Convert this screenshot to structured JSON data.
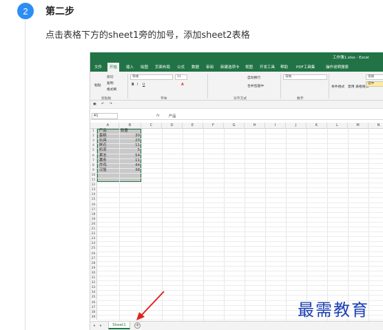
{
  "step": {
    "number": "2",
    "title": "第二步",
    "description": "点击表格下方的sheet1旁的加号，添加sheet2表格"
  },
  "excel": {
    "window_title": "工作簿1.xlsx - Excel",
    "menu": [
      "文件",
      "开始",
      "插入",
      "绘图",
      "页面布局",
      "公式",
      "数据",
      "审阅",
      "新建选项卡",
      "视图",
      "开发工具",
      "帮助",
      "PDF工具集",
      "操作说明搜索"
    ],
    "active_menu": "开始",
    "ribbon": {
      "paste": "粘贴",
      "cut": "剪切",
      "copy": "复制",
      "format_painter": "格式刷",
      "font_name": "等线",
      "font_size": "11",
      "wrap_text": "自动换行",
      "merge_center": "合并后居中",
      "number_format": "常规",
      "conditional_format": "条件格式",
      "table_format": "套用\n表格格式",
      "style_box": "常规",
      "style_bad": "适中",
      "group_clipboard": "剪贴板",
      "group_font": "字体",
      "group_alignment": "对齐方式",
      "group_number": "数字"
    },
    "name_box": "A1",
    "formula_value": "产品",
    "columns": [
      "A",
      "B",
      "C",
      "D",
      "E",
      "F",
      "G",
      "H",
      "I",
      "J",
      "K",
      "L",
      "M",
      "N"
    ],
    "rows": [
      "1",
      "2",
      "3",
      "4",
      "5",
      "6",
      "7",
      "8",
      "9",
      "10",
      "11",
      "12",
      "13",
      "14",
      "15",
      "16",
      "17",
      "18",
      "19",
      "20",
      "21",
      "22",
      "23",
      "24",
      "25",
      "26",
      "27",
      "28",
      "29",
      "30",
      "31",
      "32",
      "33",
      "34",
      "35",
      "36",
      "37",
      "38",
      "39"
    ],
    "table": {
      "headers": [
        "产品",
        "数量"
      ],
      "rows": [
        [
          "蛋糕",
          "30"
        ],
        [
          "玩具",
          "20"
        ],
        [
          "鲜花",
          "11"
        ],
        [
          "奶茶",
          "5"
        ],
        [
          "果冻",
          "54"
        ],
        [
          "薯条",
          "11"
        ],
        [
          "炸鸡",
          "44"
        ],
        [
          "汉堡",
          "38"
        ]
      ]
    },
    "sheet_tab": "Sheet1",
    "add_sheet_symbol": "+"
  },
  "watermark": "最需教育",
  "colors": {
    "excel_green": "#217346",
    "badge_blue": "#2c8ef4",
    "arrow_red": "#e02020",
    "watermark_blue": "#1a3fb5"
  }
}
